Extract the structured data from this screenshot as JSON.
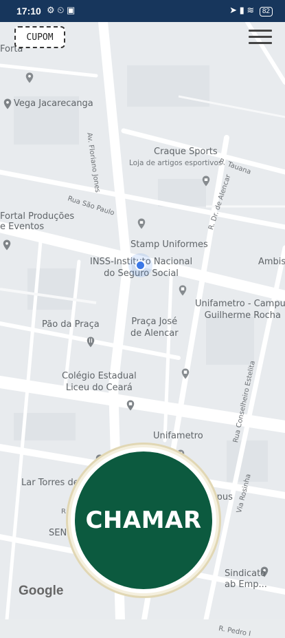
{
  "status_bar": {
    "time": "17:10",
    "left_icons": "⚙ ⏲ ▣",
    "right_icons": "➤ ▮ ≋",
    "battery": "82"
  },
  "top": {
    "coupon_label": "CUPOM",
    "menu_icon": "hamburger-menu-icon"
  },
  "map_labels": {
    "forta_partial": "Forta",
    "vega": "Vega Jacarecanga",
    "av_floriano": "Av. Floriano Jones",
    "craque_sports": "Craque Sports",
    "loja": "Loja de artigos esportivos",
    "rua_tauna": "R. Tauana",
    "rua_sao_paulo": "Rua São Paulo",
    "fortal_producoes": "Fortal Produções\ne Eventos",
    "stamp": "Stamp Uniformes",
    "inss": "INSS-Instituto Nacional\ndo Seguro Social",
    "r_dr_alencar": "R. Dr. de Alencar",
    "ambis": "Ambis",
    "unifametro_campus": "Unifametro - Campus\nGuilherme Rocha",
    "pao": "Pão da Praça",
    "praca": "Praça José\nde Alencar",
    "colegio": "Colégio Estadual\nLiceu do Ceará",
    "unifametro": "Unifametro",
    "rua_conselheiro": "Rua Conselheiro Estelita",
    "lar_torres": "Lar Torres de Melo",
    "campus": "ampus",
    "via_rosinha": "Via Rosinha",
    "r_ji": "R. Ji",
    "sen": "SEN",
    "sindicato": "Sindicato\nab Emp...",
    "r_pedro": "R. Pedro I"
  },
  "call_button": "CHAMAR",
  "google_logo": "Google"
}
